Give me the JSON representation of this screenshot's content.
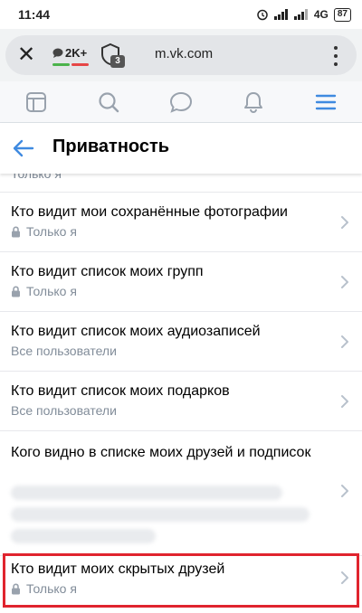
{
  "status_bar": {
    "time": "11:44",
    "network": "4G",
    "battery": "87"
  },
  "browser": {
    "close_icon": "close-icon",
    "chat_count": "2K+",
    "tabs_count": "3",
    "url": "m.vk.com",
    "menu_icon": "more-vert-icon"
  },
  "nav": {
    "icons": [
      "feed-icon",
      "search-icon",
      "messages-icon",
      "notifications-icon",
      "menu-icon"
    ],
    "accent": "#3f8ae0"
  },
  "header": {
    "title": "Приватность"
  },
  "list": {
    "cut_off_label": "Только я",
    "items": [
      {
        "title": "Кто видит мои сохранённые фотографии",
        "subtitle": "Только я",
        "locked": true
      },
      {
        "title": "Кто видит список моих групп",
        "subtitle": "Только я",
        "locked": true
      },
      {
        "title": "Кто видит список моих аудиозаписей",
        "subtitle": "Все пользователи",
        "locked": false
      },
      {
        "title": "Кто видит список моих подарков",
        "subtitle": "Все пользователи",
        "locked": false
      },
      {
        "title": "Кого видно в списке моих друзей и подписок",
        "subtitle": "",
        "locked": false
      },
      {
        "title": "Кто видит моих скрытых друзей",
        "subtitle": "Только я",
        "locked": true
      }
    ]
  },
  "colors": {
    "highlight": "#e0242e",
    "secondary_text": "#818c99",
    "chat_bar_green": "#4bb34b",
    "chat_bar_red": "#e64646"
  }
}
